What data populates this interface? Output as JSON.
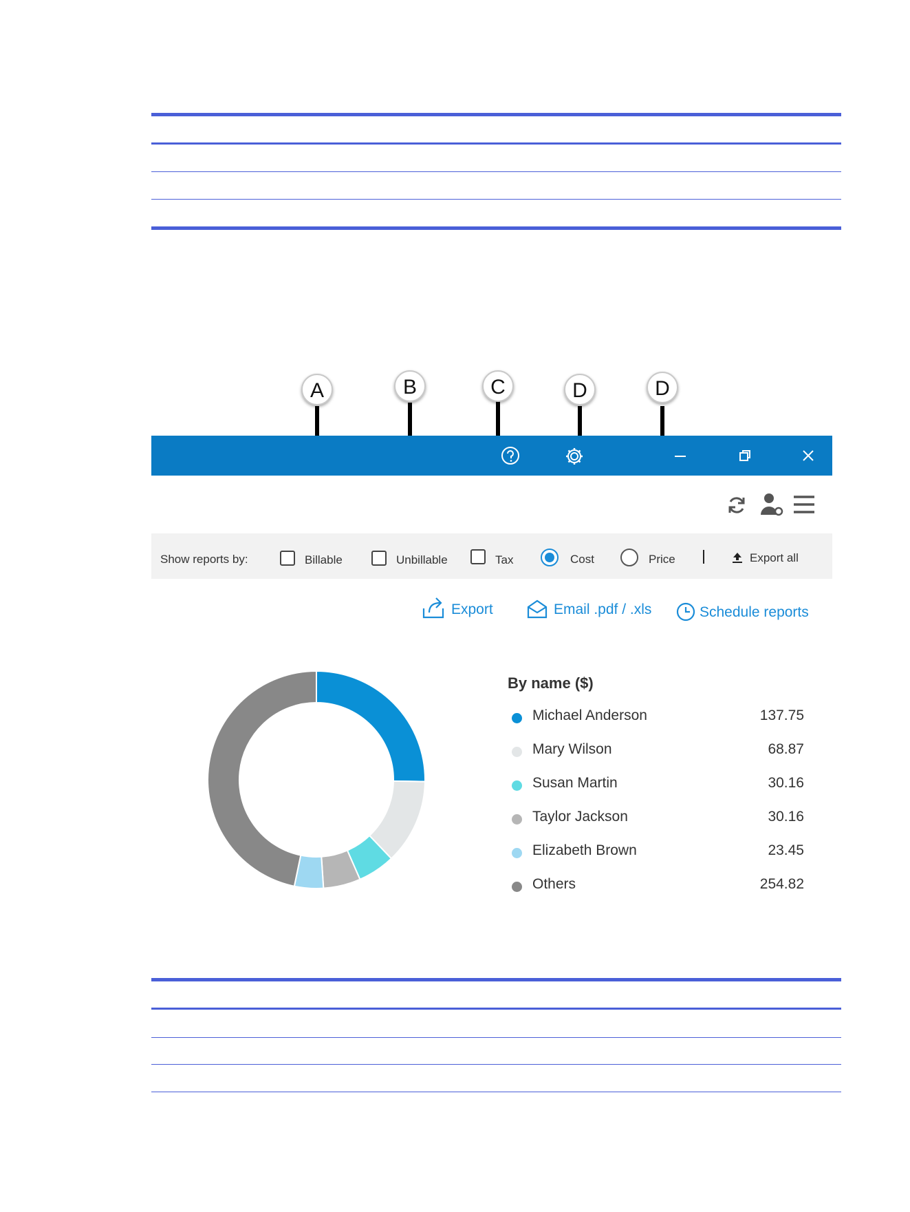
{
  "callouts": [
    "A",
    "B",
    "C",
    "D",
    "D"
  ],
  "window": {
    "title_icons": [
      "help-icon",
      "settings-icon",
      "minimize-icon",
      "restore-icon",
      "close-icon"
    ],
    "toolbar_icons": [
      "refresh-icon",
      "user-settings-icon",
      "menu-icon"
    ],
    "accent": "#0a7bc4"
  },
  "filters": {
    "label": "Show reports by:",
    "billable": "Billable",
    "unbillable": "Unbillable",
    "tax": "Tax",
    "cost": "Cost",
    "price": "Price",
    "selected": "Cost",
    "export_all": "Export all"
  },
  "actions": {
    "export": "Export",
    "email": "Email .pdf / .xls",
    "schedule": "Schedule reports"
  },
  "chart_data": {
    "type": "pie",
    "title": "By name ($)",
    "categories": [
      "Michael Anderson",
      "Mary Wilson",
      "Susan Martin",
      "Taylor Jackson",
      "Elizabeth Brown",
      "Others"
    ],
    "values": [
      137.75,
      68.87,
      30.16,
      30.16,
      23.45,
      254.82
    ],
    "value_labels": [
      "137.75",
      "68.87",
      "30.16",
      "30.16",
      "23.45",
      "254.82"
    ],
    "colors": [
      "#0a90d6",
      "#e3e6e7",
      "#5fdbe3",
      "#b6b6b6",
      "#9ed8f2",
      "#888888"
    ],
    "donut": true
  }
}
